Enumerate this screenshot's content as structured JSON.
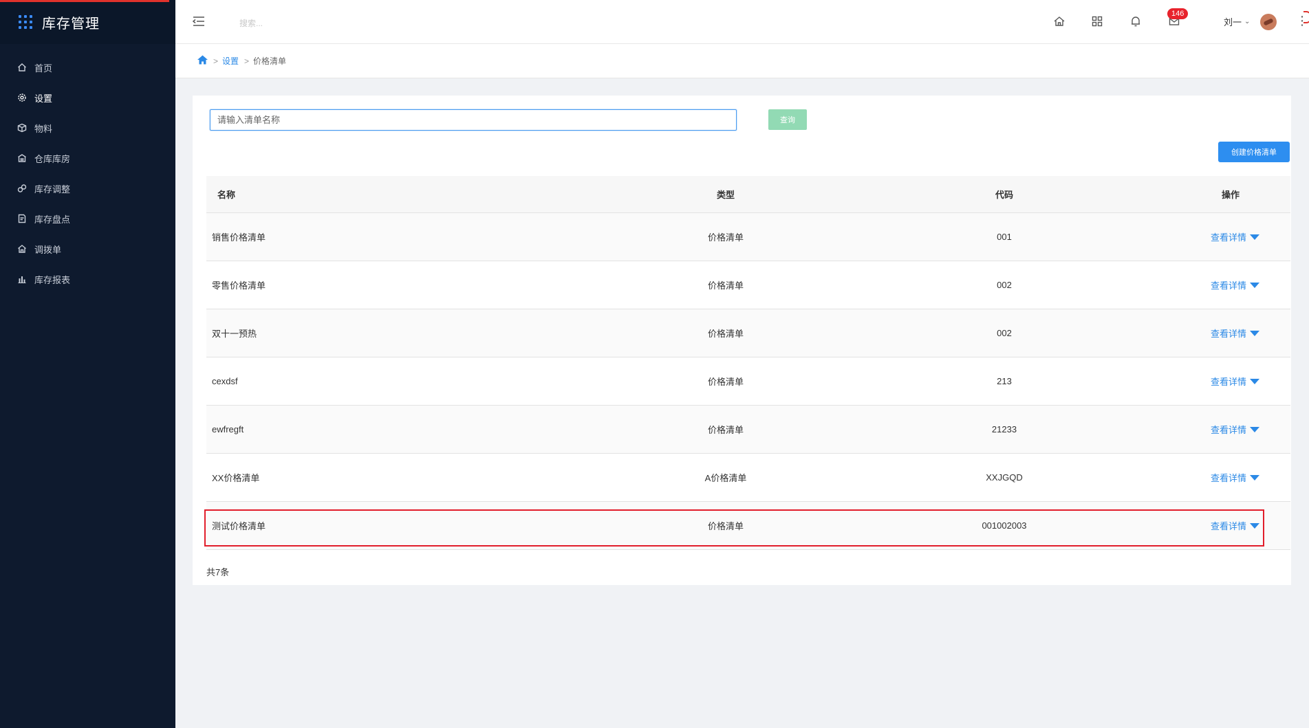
{
  "app": {
    "title": "库存管理"
  },
  "sidebar": {
    "items": [
      {
        "label": "首页",
        "icon": "home-icon"
      },
      {
        "label": "设置",
        "icon": "gear-icon"
      },
      {
        "label": "物料",
        "icon": "cube-icon"
      },
      {
        "label": "仓库库房",
        "icon": "warehouse-icon"
      },
      {
        "label": "库存调整",
        "icon": "adjust-icon"
      },
      {
        "label": "库存盘点",
        "icon": "inventory-icon"
      },
      {
        "label": "调拨单",
        "icon": "transfer-icon"
      },
      {
        "label": "库存报表",
        "icon": "bar-chart-icon"
      }
    ]
  },
  "header": {
    "search_placeholder": "搜索...",
    "message_count": "146",
    "user_name": "刘一"
  },
  "breadcrumb": {
    "level1": "设置",
    "level2": "价格清单"
  },
  "filter": {
    "input_placeholder": "请输入清单名称",
    "query_label": "查询",
    "create_label": "创建价格清单"
  },
  "table": {
    "columns": [
      "名称",
      "类型",
      "代码",
      "操作"
    ],
    "rows": [
      {
        "name": "销售价格清单",
        "type": "价格清单",
        "code": "001",
        "action": "查看详情"
      },
      {
        "name": "零售价格清单",
        "type": "价格清单",
        "code": "002",
        "action": "查看详情"
      },
      {
        "name": "双十一预热",
        "type": "价格清单",
        "code": "002",
        "action": "查看详情"
      },
      {
        "name": "cexdsf",
        "type": "价格清单",
        "code": "213",
        "action": "查看详情"
      },
      {
        "name": "ewfregft",
        "type": "价格清单",
        "code": "21233",
        "action": "查看详情"
      },
      {
        "name": "XX价格清单",
        "type": "A价格清单",
        "code": "XXJGQD",
        "action": "查看详情"
      },
      {
        "name": "测试价格清单",
        "type": "价格清单",
        "code": "001002003",
        "action": "查看详情"
      }
    ],
    "total": "共7条"
  },
  "colors": {
    "sidebar_bg": "#0e1a2e",
    "primary": "#2d8ef0",
    "query_button": "#92dab4",
    "highlight_border": "#e11d2a",
    "badge": "#e8232c"
  }
}
